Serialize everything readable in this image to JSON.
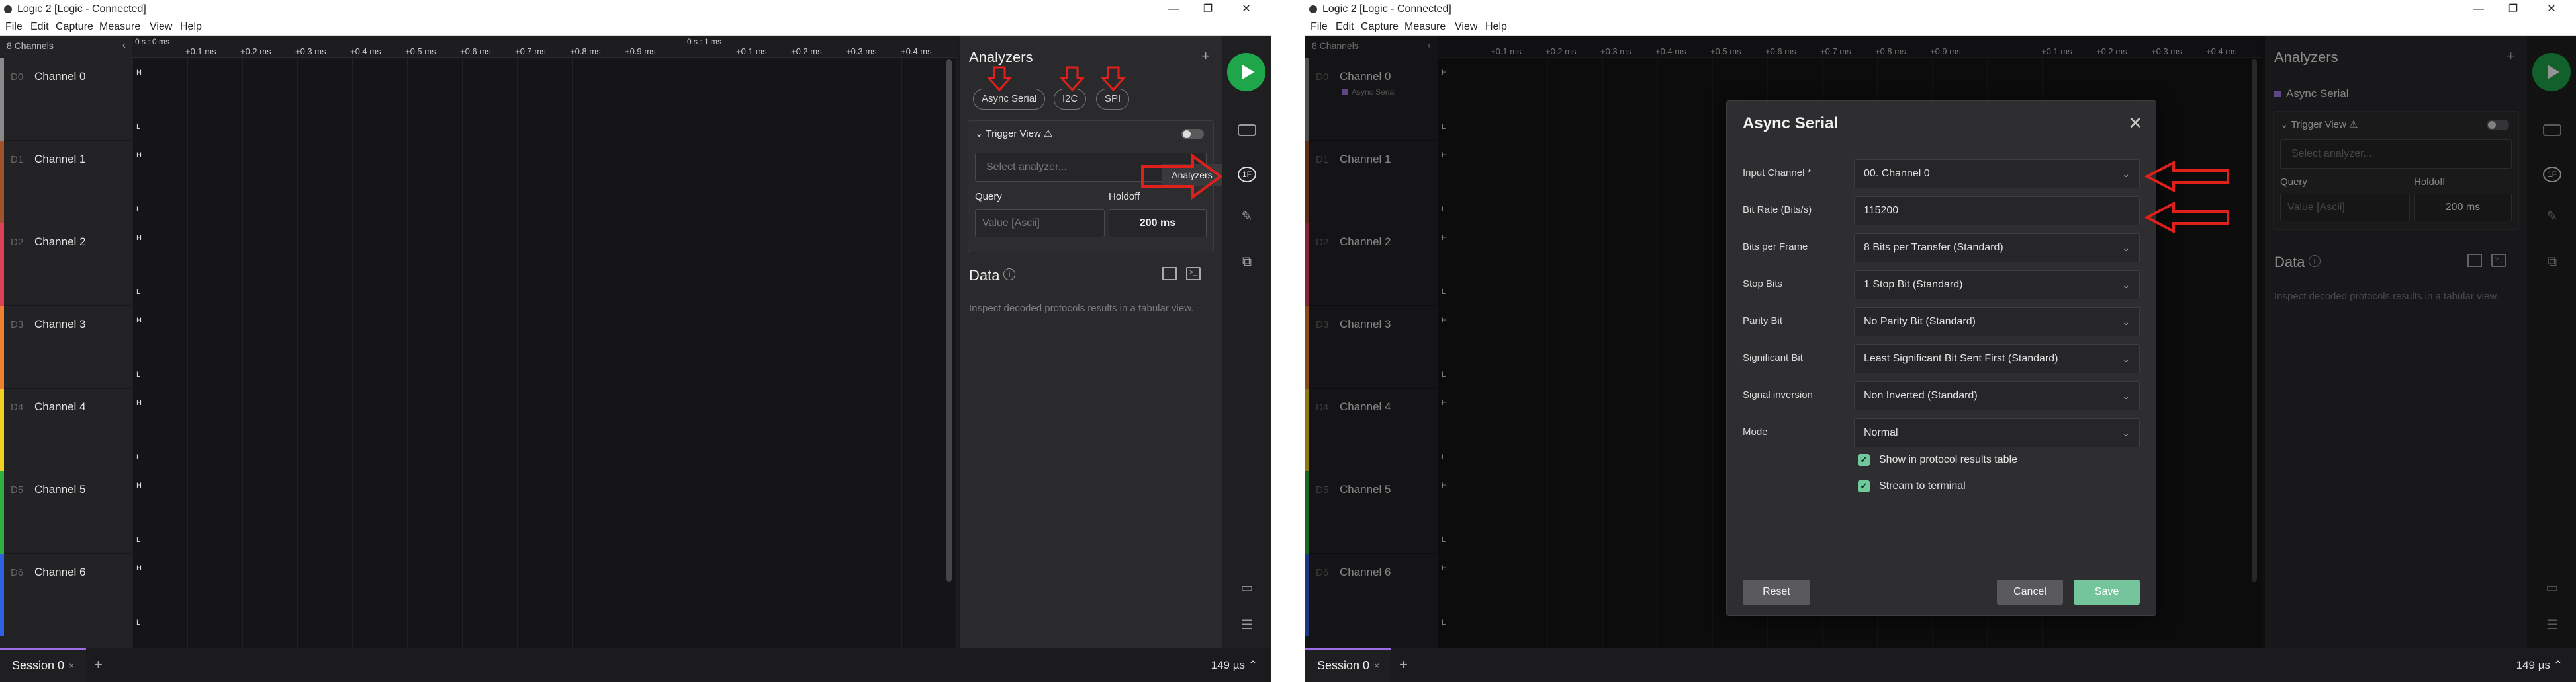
{
  "window": {
    "title": "Logic 2 [Logic - Connected]",
    "controls": [
      "—",
      "❐",
      "✕"
    ]
  },
  "menu": [
    "File",
    "Edit",
    "Capture",
    "Measure",
    "View",
    "Help"
  ],
  "channels_header": "8 Channels",
  "channels": [
    {
      "num": "D0",
      "name": "Channel 0",
      "color": "#8a8a8a"
    },
    {
      "num": "D1",
      "name": "Channel 1",
      "color": "#a0522d"
    },
    {
      "num": "D2",
      "name": "Channel 2",
      "color": "#e0405a"
    },
    {
      "num": "D3",
      "name": "Channel 3",
      "color": "#f08030"
    },
    {
      "num": "D4",
      "name": "Channel 4",
      "color": "#f0d020"
    },
    {
      "num": "D5",
      "name": "Channel 5",
      "color": "#30b040"
    },
    {
      "num": "D6",
      "name": "Channel 6",
      "color": "#3060e0"
    }
  ],
  "timeline": {
    "start": "0 s : 0 ms",
    "mid": "0 s : 1 ms",
    "ticks_a": [
      "+0.1 ms",
      "+0.2 ms",
      "+0.3 ms",
      "+0.4 ms",
      "+0.5 ms",
      "+0.6 ms",
      "+0.7 ms",
      "+0.8 ms",
      "+0.9 ms"
    ],
    "ticks_b": [
      "+0.1 ms",
      "+0.2 ms",
      "+0.3 ms",
      "+0.4 ms"
    ],
    "high": "H",
    "low": "L"
  },
  "analyzers": {
    "title": "Analyzers",
    "add": "+",
    "chips": [
      "Async Serial",
      "I2C",
      "SPI"
    ],
    "added": "Async Serial",
    "trigger_view": "Trigger View",
    "select_placeholder": "Select analyzer...",
    "query_label": "Query",
    "holdoff_label": "Holdoff",
    "query_placeholder": "Value [Ascii]",
    "holdoff_value": "200 ms",
    "tooltip": "Analyzers"
  },
  "data_panel": {
    "title": "Data",
    "info": "i",
    "text": "Inspect decoded protocols results in a tabular view."
  },
  "sidebar": {
    "analyzer_icon": "1F"
  },
  "session": {
    "tab": "Session 0",
    "close": "×",
    "add": "+",
    "rate": "149 µs ⌃"
  },
  "dialog": {
    "title": "Async Serial",
    "close": "✕",
    "fields": [
      {
        "label": "Input Channel *",
        "value": "00.  Channel 0",
        "dropdown": true
      },
      {
        "label": "Bit Rate (Bits/s)",
        "value": "115200",
        "dropdown": false
      },
      {
        "label": "Bits per Frame",
        "value": "8 Bits per Transfer (Standard)",
        "dropdown": true
      },
      {
        "label": "Stop Bits",
        "value": "1 Stop Bit (Standard)",
        "dropdown": true
      },
      {
        "label": "Parity Bit",
        "value": "No Parity Bit (Standard)",
        "dropdown": true
      },
      {
        "label": "Significant Bit",
        "value": "Least Significant Bit Sent First (Standard)",
        "dropdown": true
      },
      {
        "label": "Signal inversion",
        "value": "Non Inverted (Standard)",
        "dropdown": true
      },
      {
        "label": "Mode",
        "value": "Normal",
        "dropdown": true
      }
    ],
    "checkboxes": [
      "Show in protocol results table",
      "Stream to terminal"
    ],
    "reset": "Reset",
    "cancel": "Cancel",
    "save": "Save"
  },
  "colors": {
    "accent_green": "#1fa54a",
    "annotation_arrow": "#e0201a",
    "session_accent": "#9d6de8",
    "save_button": "#74c49c",
    "checkbox": "#6fc99b"
  }
}
